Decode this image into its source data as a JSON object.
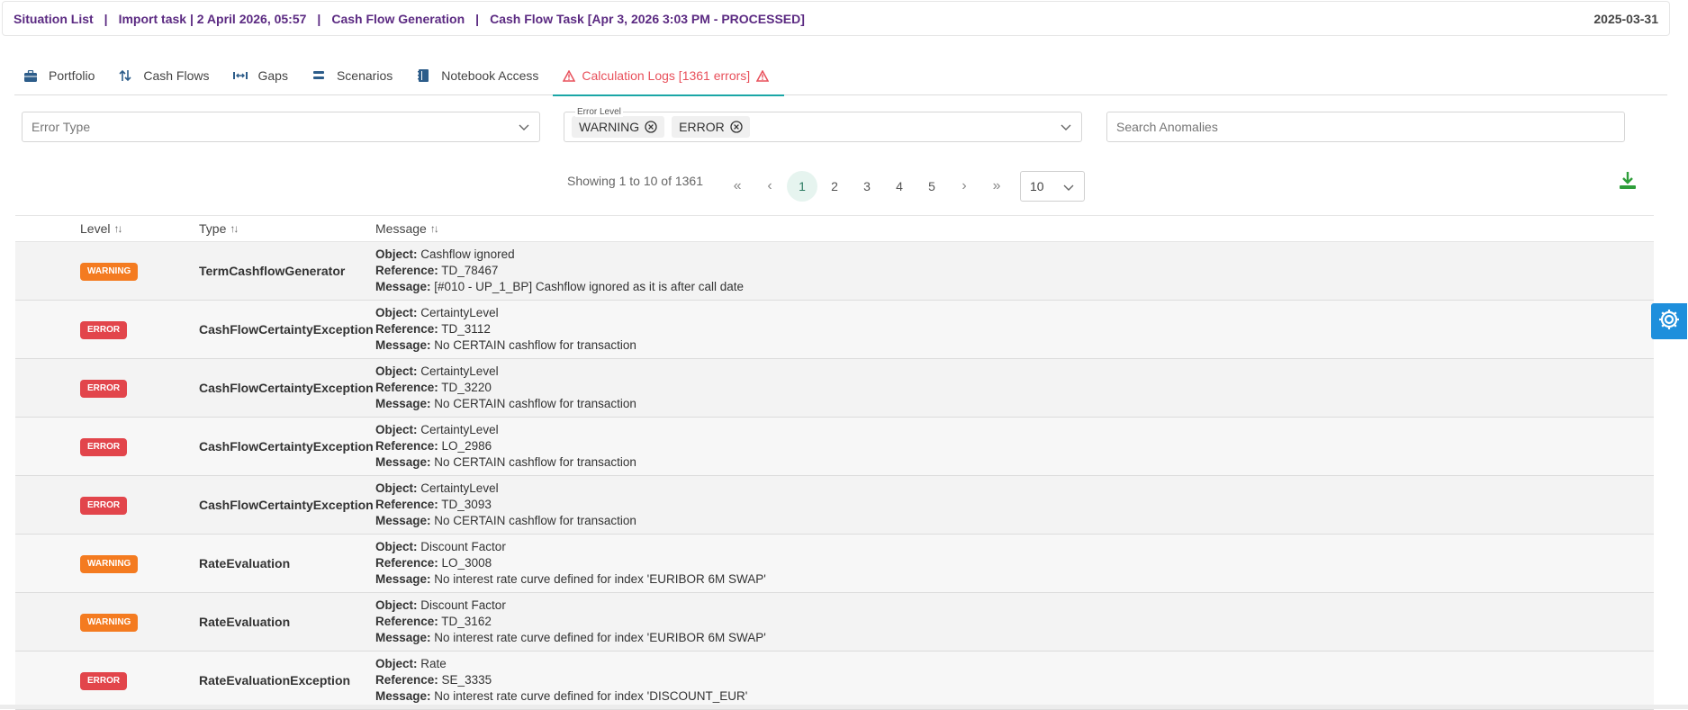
{
  "breadcrumb": {
    "items": [
      "Situation List",
      "Import task | 2 April 2026, 05:57",
      "Cash Flow Generation",
      "Cash Flow Task [Apr 3, 2026 3:03 PM - PROCESSED]"
    ],
    "separator": "|",
    "date": "2025-03-31"
  },
  "tabs": [
    {
      "label": "Portfolio",
      "icon": "briefcase-icon"
    },
    {
      "label": "Cash Flows",
      "icon": "arrows-updown-icon"
    },
    {
      "label": "Gaps",
      "icon": "gap-icon"
    },
    {
      "label": "Scenarios",
      "icon": "layers-icon"
    },
    {
      "label": "Notebook Access",
      "icon": "notebook-icon"
    },
    {
      "label": "Calculation Logs [1361 errors]",
      "icon": "warning-icon",
      "active": true
    }
  ],
  "filters": {
    "error_type_placeholder": "Error Type",
    "error_level_label": "Error Level",
    "error_level_chips": [
      "WARNING",
      "ERROR"
    ],
    "search_placeholder": "Search Anomalies"
  },
  "pagination": {
    "showing": "Showing 1 to 10 of 1361",
    "first": "«",
    "prev": "‹",
    "pages": [
      "1",
      "2",
      "3",
      "4",
      "5"
    ],
    "current": "1",
    "next": "›",
    "last": "»",
    "rows_per_page": "10"
  },
  "table": {
    "headers": {
      "level": "Level",
      "type": "Type",
      "message": "Message"
    },
    "field_labels": {
      "object": "Object:",
      "reference": "Reference:",
      "message": "Message:"
    },
    "rows": [
      {
        "level": "WARNING",
        "type": "TermCashflowGenerator",
        "object": "Cashflow ignored",
        "reference": "TD_78467",
        "message": "[#010 - UP_1_BP] Cashflow ignored as it is after call date"
      },
      {
        "level": "ERROR",
        "type": "CashFlowCertaintyException",
        "object": "CertaintyLevel",
        "reference": "TD_3112",
        "message": "No CERTAIN cashflow for transaction"
      },
      {
        "level": "ERROR",
        "type": "CashFlowCertaintyException",
        "object": "CertaintyLevel",
        "reference": "TD_3220",
        "message": "No CERTAIN cashflow for transaction"
      },
      {
        "level": "ERROR",
        "type": "CashFlowCertaintyException",
        "object": "CertaintyLevel",
        "reference": "LO_2986",
        "message": "No CERTAIN cashflow for transaction"
      },
      {
        "level": "ERROR",
        "type": "CashFlowCertaintyException",
        "object": "CertaintyLevel",
        "reference": "TD_3093",
        "message": "No CERTAIN cashflow for transaction"
      },
      {
        "level": "WARNING",
        "type": "RateEvaluation",
        "object": "Discount Factor",
        "reference": "LO_3008",
        "message": "No interest rate curve defined for index 'EURIBOR 6M SWAP'"
      },
      {
        "level": "WARNING",
        "type": "RateEvaluation",
        "object": "Discount Factor",
        "reference": "TD_3162",
        "message": "No interest rate curve defined for index 'EURIBOR 6M SWAP'"
      },
      {
        "level": "ERROR",
        "type": "RateEvaluationException",
        "object": "Rate",
        "reference": "SE_3335",
        "message": "No interest rate curve defined for index 'DISCOUNT_EUR'"
      }
    ]
  },
  "colors": {
    "warning": "#f47b20",
    "error": "#e2454b",
    "accent": "#1aa6a6",
    "breadcrumb": "#5b2a82",
    "gear_button": "#1e8fdc",
    "download": "#2e9e3a"
  }
}
